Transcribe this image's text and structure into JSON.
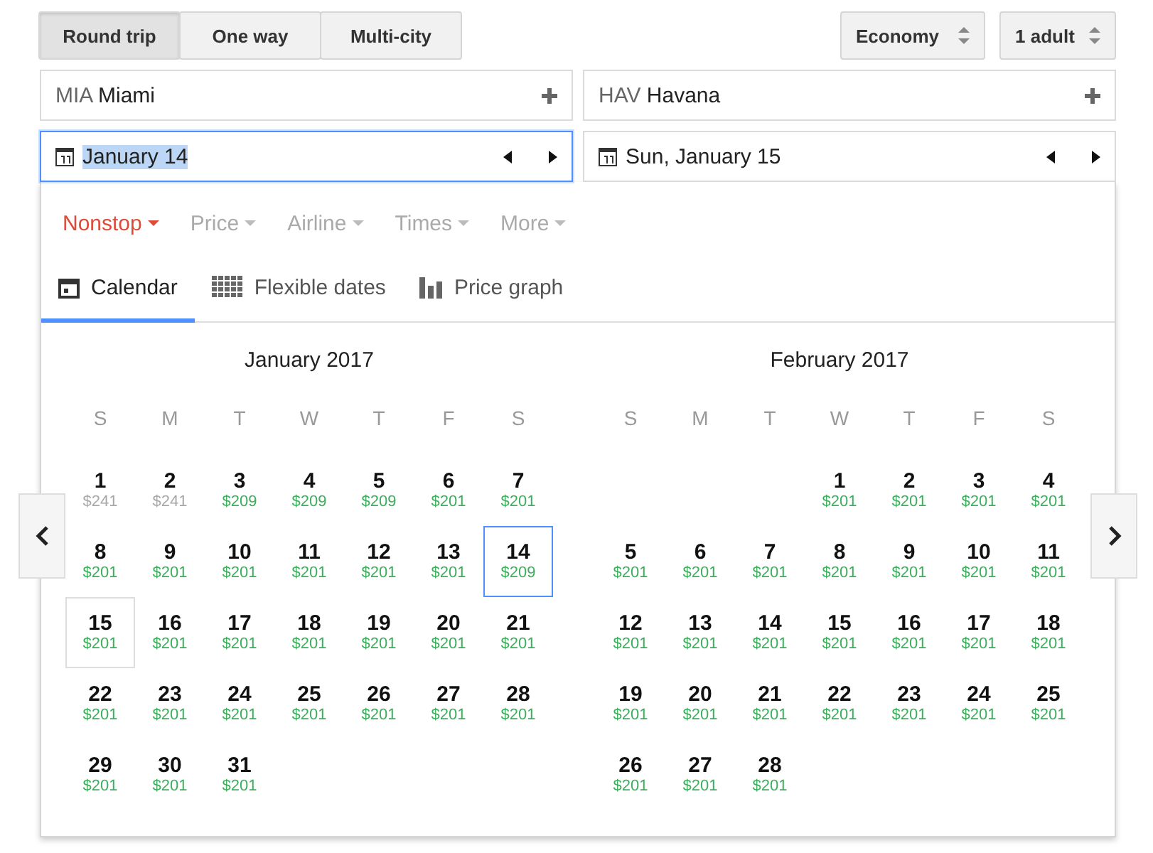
{
  "trip_types": [
    {
      "label": "Round trip",
      "selected": true
    },
    {
      "label": "One way",
      "selected": false
    },
    {
      "label": "Multi-city",
      "selected": false
    }
  ],
  "cabin": {
    "value": "Economy"
  },
  "passengers": {
    "value": "1 adult"
  },
  "places": [
    {
      "code": "MIA",
      "city": "Miami"
    },
    {
      "code": "HAV",
      "city": "Havana"
    }
  ],
  "dates": [
    {
      "value": "January 14",
      "focused": true,
      "text_selected": true
    },
    {
      "value": "Sun, January 15",
      "focused": false,
      "text_selected": false
    }
  ],
  "filters": [
    {
      "label": "Nonstop",
      "active": true
    },
    {
      "label": "Price",
      "active": false
    },
    {
      "label": "Airline",
      "active": false
    },
    {
      "label": "Times",
      "active": false
    },
    {
      "label": "More",
      "active": false
    }
  ],
  "views": [
    {
      "label": "Calendar",
      "kind": "calendar",
      "selected": true
    },
    {
      "label": "Flexible dates",
      "kind": "grid",
      "selected": false
    },
    {
      "label": "Price graph",
      "kind": "bars",
      "selected": false
    }
  ],
  "months": [
    {
      "title": "January 2017",
      "weekdays": [
        "S",
        "M",
        "T",
        "W",
        "T",
        "F",
        "S"
      ],
      "weeks": [
        [
          {
            "kind": "day",
            "day": "1",
            "price": "$241",
            "color": "#a8a8a8",
            "depart": false,
            "return": false
          },
          {
            "kind": "day",
            "day": "2",
            "price": "$241",
            "color": "#a8a8a8",
            "depart": false,
            "return": false
          },
          {
            "kind": "day",
            "day": "3",
            "price": "$209",
            "color": "#3cae5c",
            "depart": false,
            "return": false
          },
          {
            "kind": "day",
            "day": "4",
            "price": "$209",
            "color": "#3cae5c",
            "depart": false,
            "return": false
          },
          {
            "kind": "day",
            "day": "5",
            "price": "$209",
            "color": "#3cae5c",
            "depart": false,
            "return": false
          },
          {
            "kind": "day",
            "day": "6",
            "price": "$201",
            "color": "#3cae5c",
            "depart": false,
            "return": false
          },
          {
            "kind": "day",
            "day": "7",
            "price": "$201",
            "color": "#3cae5c",
            "depart": false,
            "return": false
          }
        ],
        [
          {
            "kind": "day",
            "day": "8",
            "price": "$201",
            "color": "#3cae5c",
            "depart": false,
            "return": false
          },
          {
            "kind": "day",
            "day": "9",
            "price": "$201",
            "color": "#3cae5c",
            "depart": false,
            "return": false
          },
          {
            "kind": "day",
            "day": "10",
            "price": "$201",
            "color": "#3cae5c",
            "depart": false,
            "return": false
          },
          {
            "kind": "day",
            "day": "11",
            "price": "$201",
            "color": "#3cae5c",
            "depart": false,
            "return": false
          },
          {
            "kind": "day",
            "day": "12",
            "price": "$201",
            "color": "#3cae5c",
            "depart": false,
            "return": false
          },
          {
            "kind": "day",
            "day": "13",
            "price": "$201",
            "color": "#3cae5c",
            "depart": false,
            "return": false
          },
          {
            "kind": "day",
            "day": "14",
            "price": "$209",
            "color": "#3cae5c",
            "depart": true,
            "return": false
          }
        ],
        [
          {
            "kind": "day",
            "day": "15",
            "price": "$201",
            "color": "#3cae5c",
            "depart": false,
            "return": true
          },
          {
            "kind": "day",
            "day": "16",
            "price": "$201",
            "color": "#3cae5c",
            "depart": false,
            "return": false
          },
          {
            "kind": "day",
            "day": "17",
            "price": "$201",
            "color": "#3cae5c",
            "depart": false,
            "return": false
          },
          {
            "kind": "day",
            "day": "18",
            "price": "$201",
            "color": "#3cae5c",
            "depart": false,
            "return": false
          },
          {
            "kind": "day",
            "day": "19",
            "price": "$201",
            "color": "#3cae5c",
            "depart": false,
            "return": false
          },
          {
            "kind": "day",
            "day": "20",
            "price": "$201",
            "color": "#3cae5c",
            "depart": false,
            "return": false
          },
          {
            "kind": "day",
            "day": "21",
            "price": "$201",
            "color": "#3cae5c",
            "depart": false,
            "return": false
          }
        ],
        [
          {
            "kind": "day",
            "day": "22",
            "price": "$201",
            "color": "#3cae5c",
            "depart": false,
            "return": false
          },
          {
            "kind": "day",
            "day": "23",
            "price": "$201",
            "color": "#3cae5c",
            "depart": false,
            "return": false
          },
          {
            "kind": "day",
            "day": "24",
            "price": "$201",
            "color": "#3cae5c",
            "depart": false,
            "return": false
          },
          {
            "kind": "day",
            "day": "25",
            "price": "$201",
            "color": "#3cae5c",
            "depart": false,
            "return": false
          },
          {
            "kind": "day",
            "day": "26",
            "price": "$201",
            "color": "#3cae5c",
            "depart": false,
            "return": false
          },
          {
            "kind": "day",
            "day": "27",
            "price": "$201",
            "color": "#3cae5c",
            "depart": false,
            "return": false
          },
          {
            "kind": "day",
            "day": "28",
            "price": "$201",
            "color": "#3cae5c",
            "depart": false,
            "return": false
          }
        ],
        [
          {
            "kind": "day",
            "day": "29",
            "price": "$201",
            "color": "#3cae5c",
            "depart": false,
            "return": false
          },
          {
            "kind": "day",
            "day": "30",
            "price": "$201",
            "color": "#3cae5c",
            "depart": false,
            "return": false
          },
          {
            "kind": "day",
            "day": "31",
            "price": "$201",
            "color": "#3cae5c",
            "depart": false,
            "return": false
          },
          {
            "kind": "blank"
          },
          {
            "kind": "blank"
          },
          {
            "kind": "blank"
          },
          {
            "kind": "blank"
          }
        ]
      ]
    },
    {
      "title": "February 2017",
      "weekdays": [
        "S",
        "M",
        "T",
        "W",
        "T",
        "F",
        "S"
      ],
      "weeks": [
        [
          {
            "kind": "blank"
          },
          {
            "kind": "blank"
          },
          {
            "kind": "blank"
          },
          {
            "kind": "day",
            "day": "1",
            "price": "$201",
            "color": "#3cae5c",
            "depart": false,
            "return": false
          },
          {
            "kind": "day",
            "day": "2",
            "price": "$201",
            "color": "#3cae5c",
            "depart": false,
            "return": false
          },
          {
            "kind": "day",
            "day": "3",
            "price": "$201",
            "color": "#3cae5c",
            "depart": false,
            "return": false
          },
          {
            "kind": "day",
            "day": "4",
            "price": "$201",
            "color": "#3cae5c",
            "depart": false,
            "return": false
          }
        ],
        [
          {
            "kind": "day",
            "day": "5",
            "price": "$201",
            "color": "#3cae5c",
            "depart": false,
            "return": false
          },
          {
            "kind": "day",
            "day": "6",
            "price": "$201",
            "color": "#3cae5c",
            "depart": false,
            "return": false
          },
          {
            "kind": "day",
            "day": "7",
            "price": "$201",
            "color": "#3cae5c",
            "depart": false,
            "return": false
          },
          {
            "kind": "day",
            "day": "8",
            "price": "$201",
            "color": "#3cae5c",
            "depart": false,
            "return": false
          },
          {
            "kind": "day",
            "day": "9",
            "price": "$201",
            "color": "#3cae5c",
            "depart": false,
            "return": false
          },
          {
            "kind": "day",
            "day": "10",
            "price": "$201",
            "color": "#3cae5c",
            "depart": false,
            "return": false
          },
          {
            "kind": "day",
            "day": "11",
            "price": "$201",
            "color": "#3cae5c",
            "depart": false,
            "return": false
          }
        ],
        [
          {
            "kind": "day",
            "day": "12",
            "price": "$201",
            "color": "#3cae5c",
            "depart": false,
            "return": false
          },
          {
            "kind": "day",
            "day": "13",
            "price": "$201",
            "color": "#3cae5c",
            "depart": false,
            "return": false
          },
          {
            "kind": "day",
            "day": "14",
            "price": "$201",
            "color": "#3cae5c",
            "depart": false,
            "return": false
          },
          {
            "kind": "day",
            "day": "15",
            "price": "$201",
            "color": "#3cae5c",
            "depart": false,
            "return": false
          },
          {
            "kind": "day",
            "day": "16",
            "price": "$201",
            "color": "#3cae5c",
            "depart": false,
            "return": false
          },
          {
            "kind": "day",
            "day": "17",
            "price": "$201",
            "color": "#3cae5c",
            "depart": false,
            "return": false
          },
          {
            "kind": "day",
            "day": "18",
            "price": "$201",
            "color": "#3cae5c",
            "depart": false,
            "return": false
          }
        ],
        [
          {
            "kind": "day",
            "day": "19",
            "price": "$201",
            "color": "#3cae5c",
            "depart": false,
            "return": false
          },
          {
            "kind": "day",
            "day": "20",
            "price": "$201",
            "color": "#3cae5c",
            "depart": false,
            "return": false
          },
          {
            "kind": "day",
            "day": "21",
            "price": "$201",
            "color": "#3cae5c",
            "depart": false,
            "return": false
          },
          {
            "kind": "day",
            "day": "22",
            "price": "$201",
            "color": "#3cae5c",
            "depart": false,
            "return": false
          },
          {
            "kind": "day",
            "day": "23",
            "price": "$201",
            "color": "#3cae5c",
            "depart": false,
            "return": false
          },
          {
            "kind": "day",
            "day": "24",
            "price": "$201",
            "color": "#3cae5c",
            "depart": false,
            "return": false
          },
          {
            "kind": "day",
            "day": "25",
            "price": "$201",
            "color": "#3cae5c",
            "depart": false,
            "return": false
          }
        ],
        [
          {
            "kind": "day",
            "day": "26",
            "price": "$201",
            "color": "#3cae5c",
            "depart": false,
            "return": false
          },
          {
            "kind": "day",
            "day": "27",
            "price": "$201",
            "color": "#3cae5c",
            "depart": false,
            "return": false
          },
          {
            "kind": "day",
            "day": "28",
            "price": "$201",
            "color": "#3cae5c",
            "depart": false,
            "return": false
          },
          {
            "kind": "blank"
          },
          {
            "kind": "blank"
          },
          {
            "kind": "blank"
          },
          {
            "kind": "blank"
          }
        ]
      ]
    }
  ]
}
